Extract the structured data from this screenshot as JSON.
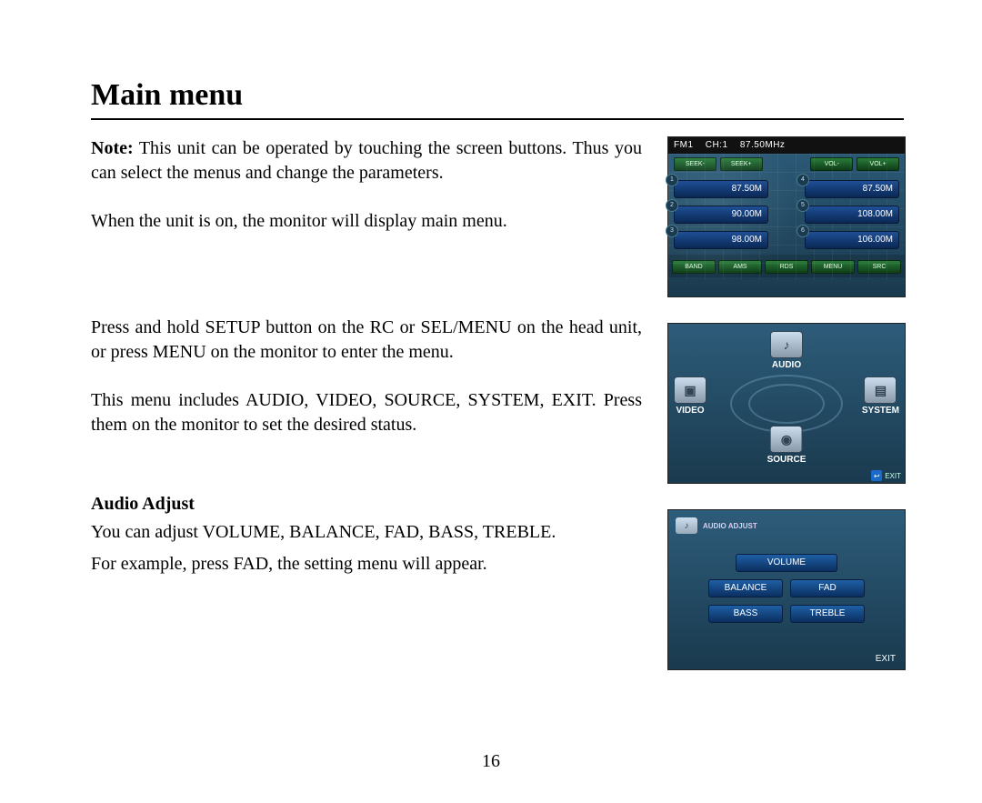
{
  "title": "Main menu",
  "note_label": "Note:",
  "note_text": " This unit can be operated by touching the screen buttons. Thus you can select the menus and change the parameters.",
  "para2": "When the unit is on, the monitor will display main menu.",
  "para3": "Press and hold SETUP button on the RC or SEL/MENU on the head unit, or press MENU on the monitor to enter the menu.",
  "para4": "This menu includes AUDIO, VIDEO, SOURCE, SYSTEM, EXIT. Press them on the monitor to set the desired status.",
  "audio_adjust_heading": "Audio Adjust",
  "audio_line1": "You can adjust VOLUME, BALANCE, FAD, BASS, TREBLE.",
  "audio_line2": "For example, press FAD, the setting menu will appear.",
  "page_number": "16",
  "radio": {
    "band": "FM1",
    "ch": "CH:1",
    "freq": "87.50MHz",
    "top_buttons": [
      "SEEK-",
      "SEEK+",
      "VOL-",
      "VOL+"
    ],
    "presets": [
      {
        "n": "1",
        "v": "87.50M"
      },
      {
        "n": "4",
        "v": "87.50M"
      },
      {
        "n": "2",
        "v": "90.00M"
      },
      {
        "n": "5",
        "v": "108.00M"
      },
      {
        "n": "3",
        "v": "98.00M"
      },
      {
        "n": "6",
        "v": "106.00M"
      }
    ],
    "bottom_buttons": [
      "BAND",
      "AMS",
      "RDS",
      "MENU",
      "SRC"
    ]
  },
  "menu": {
    "audio": "AUDIO",
    "video": "VIDEO",
    "system": "SYSTEM",
    "source": "SOURCE",
    "exit": "EXIT"
  },
  "audio_screen": {
    "header": "AUDIO ADJUST",
    "volume": "VOLUME",
    "balance": "BALANCE",
    "fad": "FAD",
    "bass": "BASS",
    "treble": "TREBLE",
    "exit": "EXIT"
  }
}
